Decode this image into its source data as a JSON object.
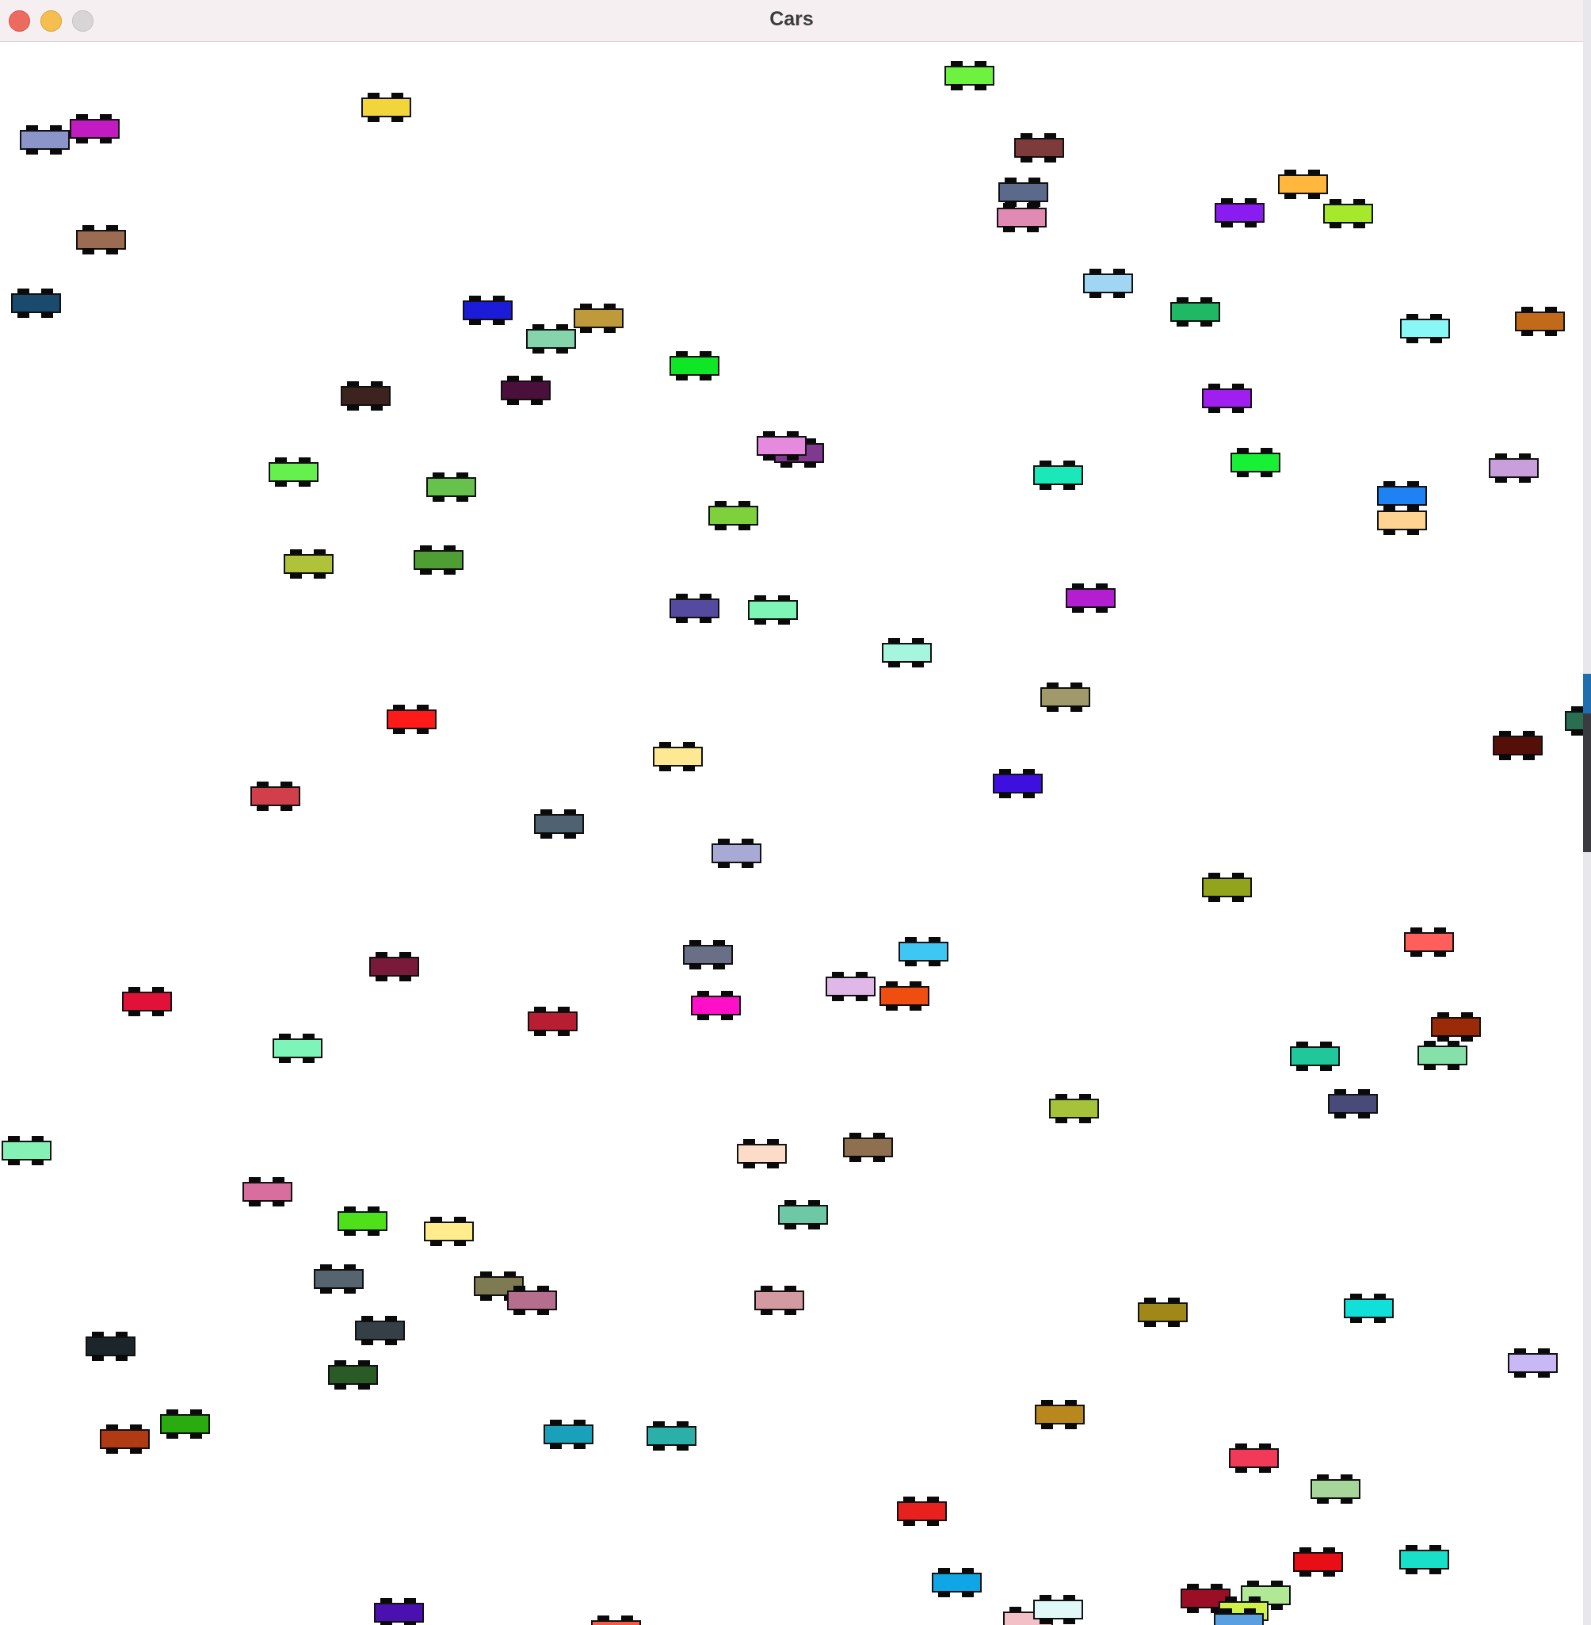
{
  "window": {
    "title": "Cars"
  },
  "cars": [
    {
      "color": "#8b95c9"
    },
    {
      "color": "#c21bc2"
    },
    {
      "color": "#f2d53b"
    },
    {
      "color": "#6ff13f"
    },
    {
      "color": "#7e3b3b"
    },
    {
      "color": "#5b6a8a"
    },
    {
      "color": "#e18ab3"
    },
    {
      "color": "#ffb83d"
    },
    {
      "color": "#8a1cf2"
    },
    {
      "color": "#a6e82b"
    },
    {
      "color": "#9b6c52"
    },
    {
      "color": "#1a4a6e"
    },
    {
      "color": "#1c1cd8"
    },
    {
      "color": "#bf9a3a"
    },
    {
      "color": "#86d4ab"
    },
    {
      "color": "#a0d6f3"
    },
    {
      "color": "#20b864"
    },
    {
      "color": "#8af7f7"
    },
    {
      "color": "#c06a1a"
    },
    {
      "color": "#0fe626"
    },
    {
      "color": "#3d2320"
    },
    {
      "color": "#4a0f3a"
    },
    {
      "color": "#a11ef0"
    },
    {
      "color": "#7f3a8f"
    },
    {
      "color": "#e68ae0"
    },
    {
      "color": "#66f04e"
    },
    {
      "color": "#66c24c"
    },
    {
      "color": "#1be8b8"
    },
    {
      "color": "#18f036"
    },
    {
      "color": "#1f82f2"
    },
    {
      "color": "#c89fdb"
    },
    {
      "color": "#ffd391"
    },
    {
      "color": "#7fd13c"
    },
    {
      "color": "#b0c23a"
    },
    {
      "color": "#4e9e34"
    },
    {
      "color": "#5549a0"
    },
    {
      "color": "#7ef5b6"
    },
    {
      "color": "#b21ed0"
    },
    {
      "color": "#a6f5de"
    },
    {
      "color": "#a09a6a"
    },
    {
      "color": "#ff1a1a"
    },
    {
      "color": "#ffe893"
    },
    {
      "color": "#2a6e52"
    },
    {
      "color": "#541008"
    },
    {
      "color": "#3e10e0"
    },
    {
      "color": "#d13f4b"
    },
    {
      "color": "#4e6272"
    },
    {
      "color": "#a9a9d6"
    },
    {
      "color": "#92a41c"
    },
    {
      "color": "#ff5f5a"
    },
    {
      "color": "#6a6f88"
    },
    {
      "color": "#3ec7f3"
    },
    {
      "color": "#7a1a3a"
    },
    {
      "color": "#e0b8e8"
    },
    {
      "color": "#f04e10"
    },
    {
      "color": "#e0123a"
    },
    {
      "color": "#ff10c8"
    },
    {
      "color": "#b81e32"
    },
    {
      "color": "#9a2a08"
    },
    {
      "color": "#7ef5b8"
    },
    {
      "color": "#1fc79a"
    },
    {
      "color": "#86e0aa"
    },
    {
      "color": "#4a4a78"
    },
    {
      "color": "#a6c23a"
    },
    {
      "color": "#84f2b4"
    },
    {
      "color": "#fcdcc8"
    },
    {
      "color": "#8e7050"
    },
    {
      "color": "#d86e9e"
    },
    {
      "color": "#4ee018"
    },
    {
      "color": "#ffec8c"
    },
    {
      "color": "#6ec7a6"
    },
    {
      "color": "#566470"
    },
    {
      "color": "#7e7a52"
    },
    {
      "color": "#b66e8e"
    },
    {
      "color": "#d49aa2"
    },
    {
      "color": "#344046"
    },
    {
      "color": "#a08818"
    },
    {
      "color": "#10e0d8"
    },
    {
      "color": "#1c262a"
    },
    {
      "color": "#2a5a26"
    },
    {
      "color": "#c8b8f5"
    },
    {
      "color": "#b03a14"
    },
    {
      "color": "#2aac10"
    },
    {
      "color": "#1aa0ba"
    },
    {
      "color": "#2ab0a8"
    },
    {
      "color": "#b8881e"
    },
    {
      "color": "#f03a58"
    },
    {
      "color": "#a6d69a"
    },
    {
      "color": "#e8201e"
    },
    {
      "color": "#e80e16"
    },
    {
      "color": "#18e0c8"
    },
    {
      "color": "#10a6e6"
    },
    {
      "color": "#9a0e26"
    },
    {
      "color": "#b0e896"
    },
    {
      "color": "#d0f04a"
    },
    {
      "color": "#5aa0e0"
    },
    {
      "color": "#4a10b0"
    },
    {
      "color": "#f25a46"
    },
    {
      "color": "#f4c0c8"
    },
    {
      "color": "#e0f8f8"
    }
  ]
}
